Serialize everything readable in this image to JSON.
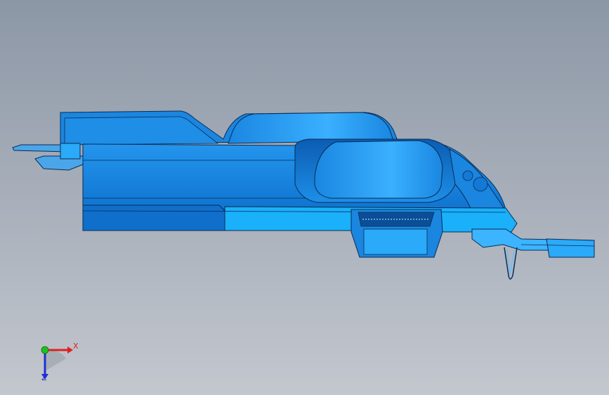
{
  "viewport": {
    "background_top": "#8c97a6",
    "background_bottom": "#c3c7ce"
  },
  "model": {
    "fill_dark": "#0a6fd0",
    "fill_main": "#1690e8",
    "fill_light": "#2aaaf8",
    "fill_highlight": "#45b8ff",
    "edge_color": "#0a2c55"
  },
  "triad": {
    "x_label": "X",
    "z_label": "Z",
    "x_color": "#e02020",
    "y_color": "#20c020",
    "z_color": "#2030d0"
  }
}
